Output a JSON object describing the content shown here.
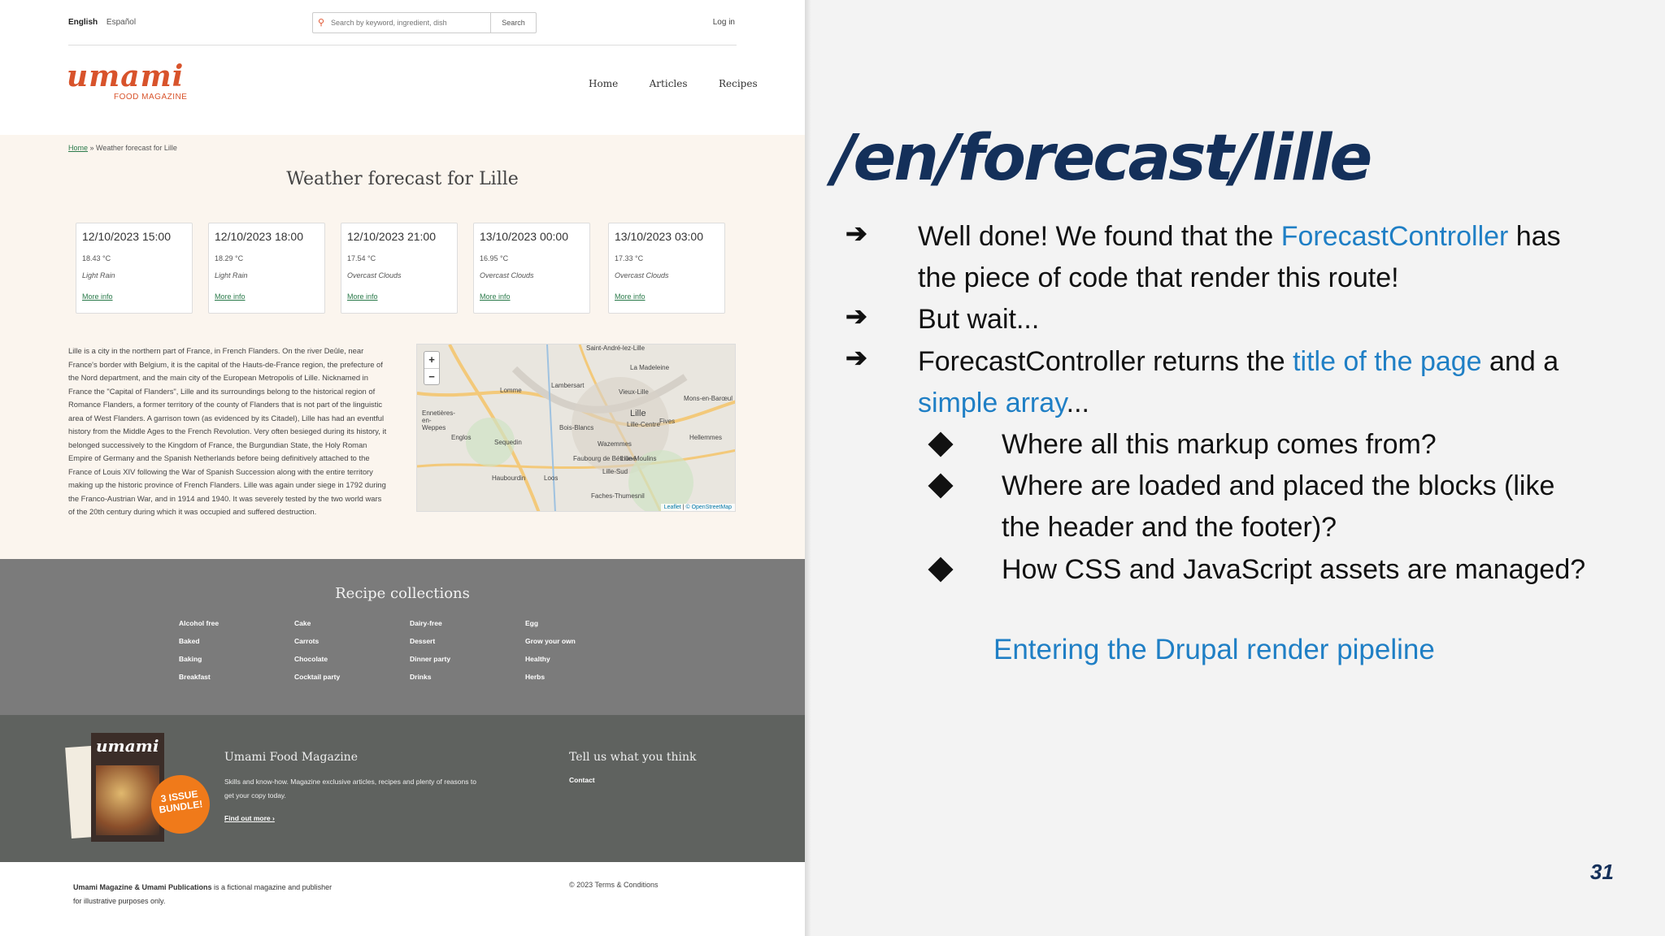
{
  "site": {
    "languages": {
      "active": "English",
      "other": "Español"
    },
    "search": {
      "placeholder": "Search by keyword, ingredient, dish",
      "button": "Search"
    },
    "login": "Log in",
    "logo": {
      "word": "umami",
      "sub": "FOOD MAGAZINE"
    },
    "nav": [
      "Home",
      "Articles",
      "Recipes"
    ],
    "breadcrumb": {
      "home": "Home",
      "separator": " » ",
      "current": "Weather forecast for Lille"
    },
    "page_title": "Weather forecast for Lille",
    "forecast": [
      {
        "datetime": "12/10/2023 15:00",
        "temp": "18.43 °C",
        "desc": "Light Rain",
        "link": "More info"
      },
      {
        "datetime": "12/10/2023 18:00",
        "temp": "18.29 °C",
        "desc": "Light Rain",
        "link": "More info"
      },
      {
        "datetime": "12/10/2023 21:00",
        "temp": "17.54 °C",
        "desc": "Overcast Clouds",
        "link": "More info"
      },
      {
        "datetime": "13/10/2023 00:00",
        "temp": "16.95 °C",
        "desc": "Overcast Clouds",
        "link": "More info"
      },
      {
        "datetime": "13/10/2023 03:00",
        "temp": "17.33 °C",
        "desc": "Overcast Clouds",
        "link": "More info"
      }
    ],
    "description": "Lille is a city in the northern part of France, in French Flanders. On the river Deûle, near France's border with Belgium, it is the capital of the Hauts-de-France region, the prefecture of the Nord department, and the main city of the European Metropolis of Lille. Nicknamed in France the \"Capital of Flanders\", Lille and its surroundings belong to the historical region of Romance Flanders, a former territory of the county of Flanders that is not part of the linguistic area of West Flanders. A garrison town (as evidenced by its Citadel), Lille has had an eventful history from the Middle Ages to the French Revolution. Very often besieged during its history, it belonged successively to the Kingdom of France, the Burgundian State, the Holy Roman Empire of Germany and the Spanish Netherlands before being definitively attached to the France of Louis XIV following the War of Spanish Succession along with the entire territory making up the historic province of French Flanders. Lille was again under siege in 1792 during the Franco-Austrian War, and in 1914 and 1940. It was severely tested by the two world wars of the 20th century during which it was occupied and suffered destruction.",
    "map": {
      "zoom_in": "+",
      "zoom_out": "−",
      "labels": [
        "Saint-André-lez-Lille",
        "La Madeleine",
        "Lambersart",
        "Lomme",
        "Vieux-Lille",
        "Mons-en-Barœul",
        "Lille",
        "Lille-Centre",
        "Fives",
        "Bois-Blancs",
        "Hellemmes",
        "Sequedin",
        "Wazemmes",
        "Faubourg de Béthune",
        "Lille-Moulins",
        "Lille-Sud",
        "Haubourdin",
        "Loos",
        "Faches-Thumesnil",
        "Englos",
        "Ennetières-en-Weppes"
      ],
      "attribution_a": "Leaflet",
      "attribution_b": "© OpenStreetMap"
    },
    "collections": {
      "title": "Recipe collections",
      "columns": [
        [
          "Alcohol free",
          "Baked",
          "Baking",
          "Breakfast"
        ],
        [
          "Cake",
          "Carrots",
          "Chocolate",
          "Cocktail party"
        ],
        [
          "Dairy-free",
          "Dessert",
          "Dinner party",
          "Drinks"
        ],
        [
          "Egg",
          "Grow your own",
          "Healthy",
          "Herbs"
        ]
      ]
    },
    "footer": {
      "magazine_word": "umami",
      "badge": "3 ISSUE BUNDLE!",
      "title": "Umami Food Magazine",
      "text": "Skills and know-how. Magazine exclusive articles, recipes and plenty of reasons to get your copy today.",
      "link": "Find out more ›",
      "tell_title": "Tell us what you think",
      "contact": "Contact",
      "copyright_bold": "Umami Magazine & Umami Publications",
      "copyright_rest": " is a fictional magazine and publisher for illustrative purposes only.",
      "terms": "© 2023 Terms & Conditions"
    }
  },
  "slide": {
    "route": "/en/forecast/lille",
    "bullets": {
      "b1_pre": "Well done! We found that the ",
      "b1_hl": "ForecastController",
      "b1_post": " has",
      "b1_line2": "the piece of code that render this route!",
      "b2": "But wait...",
      "b3_pre": "ForecastController returns the ",
      "b3_hl": "title of the page",
      "b3_post": " and a",
      "b3_hl2": "simple array",
      "b3_end": "...",
      "s1": "Where all this markup comes from?",
      "s2_line1": "Where are loaded and placed the blocks (like",
      "s2_line2": "the header and the footer)?",
      "s3": "How CSS and JavaScript assets are managed?"
    },
    "entering": "Entering the Drupal render pipeline",
    "page_number": "31",
    "colors": {
      "navy": "#14305a",
      "blue": "#1f7fc5",
      "brand": "#d8532b"
    }
  }
}
